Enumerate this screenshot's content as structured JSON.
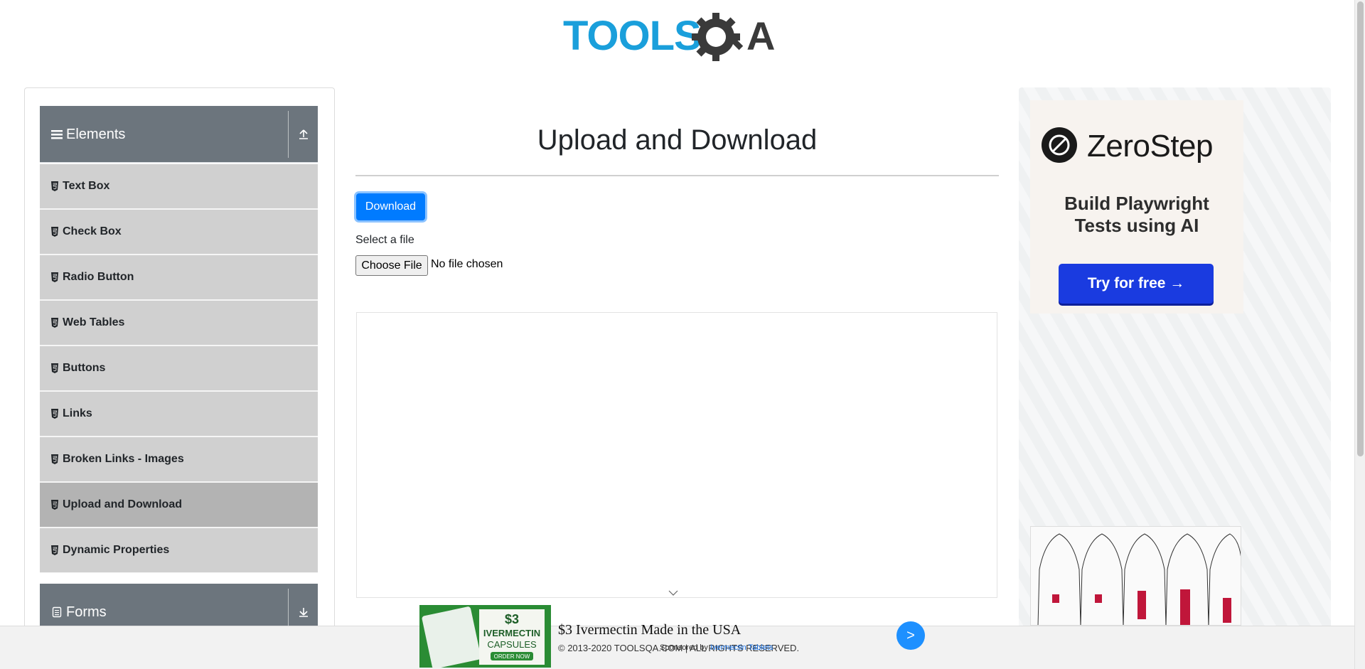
{
  "header": {
    "logo_text": "TOOLSQA"
  },
  "sidebar": {
    "groups": [
      {
        "label": "Elements",
        "icon": "hamburger-icon",
        "toggle_icon": "collapse-arrow-up-icon"
      },
      {
        "label": "Forms",
        "icon": "form-icon",
        "toggle_icon": "expand-arrow-down-icon"
      }
    ],
    "items": [
      {
        "label": "Text Box"
      },
      {
        "label": "Check Box"
      },
      {
        "label": "Radio Button"
      },
      {
        "label": "Web Tables"
      },
      {
        "label": "Buttons"
      },
      {
        "label": "Links"
      },
      {
        "label": "Broken Links - Images"
      },
      {
        "label": "Upload and Download",
        "active": true
      },
      {
        "label": "Dynamic Properties"
      }
    ]
  },
  "main": {
    "title": "Upload and Download",
    "download_label": "Download",
    "select_label": "Select a file",
    "choose_file_label": "Choose File",
    "file_status": "No file chosen"
  },
  "right_ad": {
    "brand": "ZeroStep",
    "tagline_line1": "Build Playwright",
    "tagline_line2": "Tests using AI",
    "cta": "Try for free →"
  },
  "bottom_ad": {
    "image_text_price": "$3",
    "image_text_name": "IVERMECTIN",
    "image_text_sub": "CAPSULES",
    "image_text_order": "ORDER NOW",
    "title": "$3 Ivermectin Made in the USA",
    "copyright": "© 2013-2020 TOOLSQA.COM | ALL RIGHTS RESERVED.",
    "sponsor_prefix": "Sponsored by",
    "sponsor_name": "Ivermectin Tablets",
    "next_label": ">"
  },
  "colors": {
    "primary": "#007bff",
    "sidebar_header": "#6c757d",
    "menu_item": "#d0d0d0",
    "menu_item_active": "#b3b3b3",
    "zerostep_button": "#1a3be0"
  }
}
